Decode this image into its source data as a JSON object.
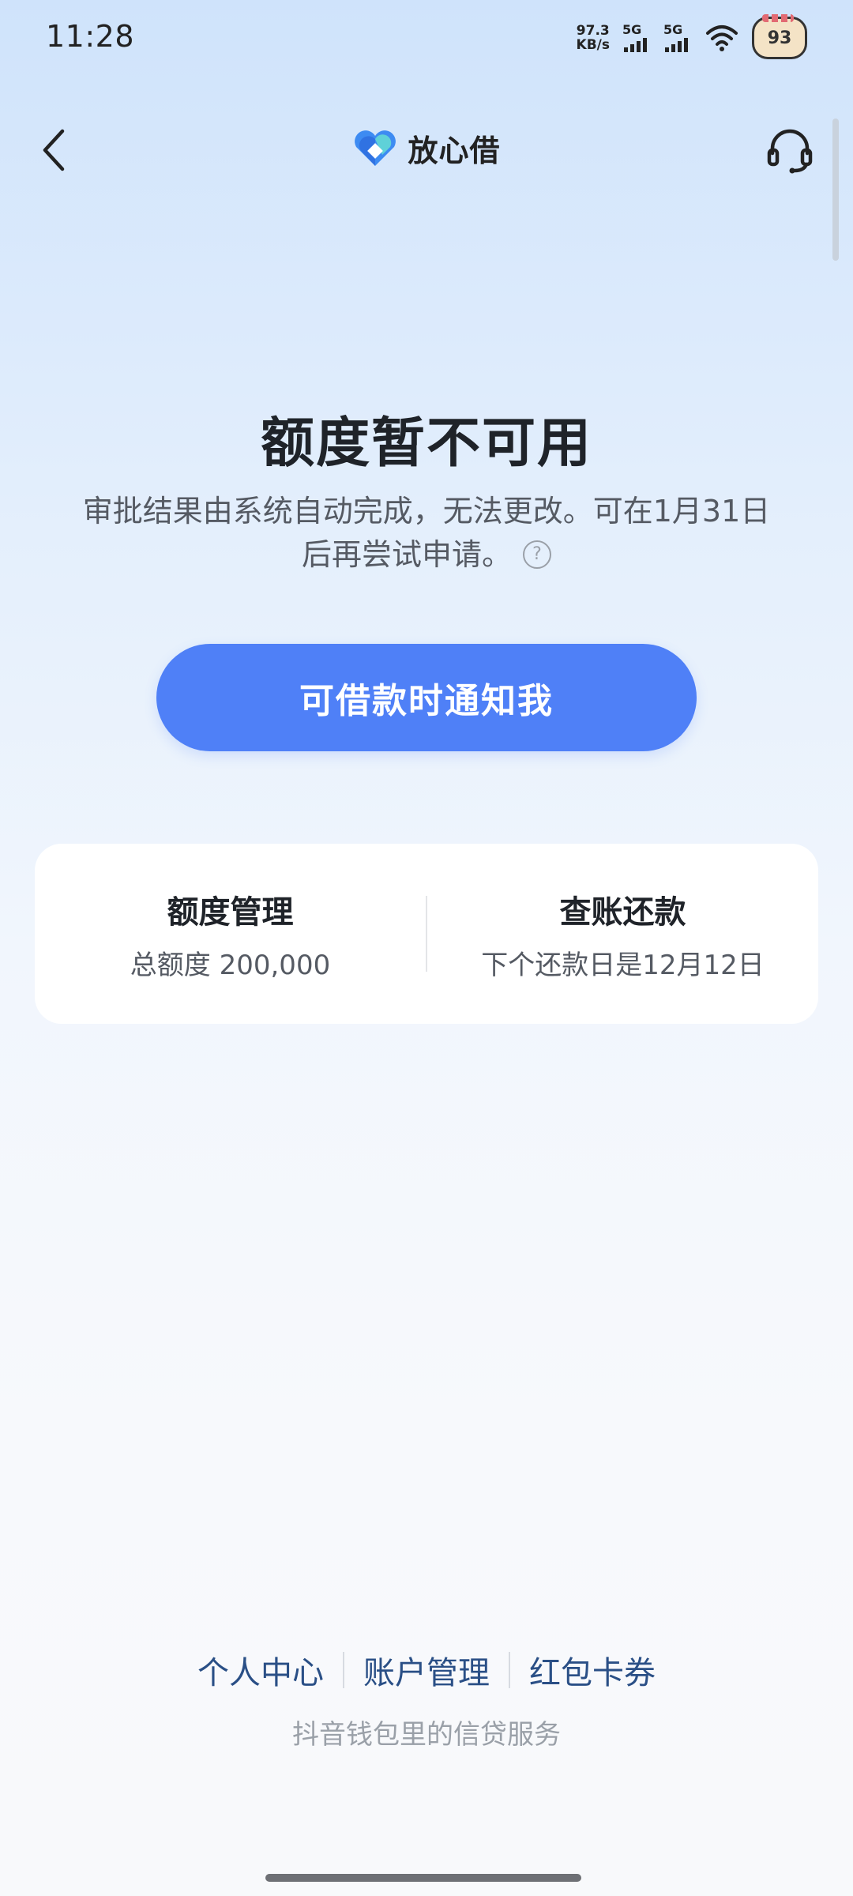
{
  "status_bar": {
    "time": "11:28",
    "net_speed_value": "97.3",
    "net_speed_unit": "KB/s",
    "signal1_label": "5G",
    "signal2_label": "5G",
    "battery_level": "93"
  },
  "header": {
    "brand_name": "放心借",
    "back_icon": "chevron-left-icon",
    "support_icon": "headset-icon"
  },
  "main": {
    "headline": "额度暂不可用",
    "subtext": "审批结果由系统自动完成，无法更改。可在1月31日后再尝试申请。",
    "help_symbol": "?",
    "notify_button_label": "可借款时通知我"
  },
  "card": {
    "left_title": "额度管理",
    "left_sub": "总额度 200,000",
    "right_title": "查账还款",
    "right_sub": "下个还款日是12月12日"
  },
  "footer": {
    "links": [
      "个人中心",
      "账户管理",
      "红包卡券"
    ],
    "note": "抖音钱包里的信贷服务"
  },
  "colors": {
    "primary": "#4f80f7",
    "link": "#2a4f86",
    "text": "#1f2329",
    "muted": "#9aa0a8"
  }
}
